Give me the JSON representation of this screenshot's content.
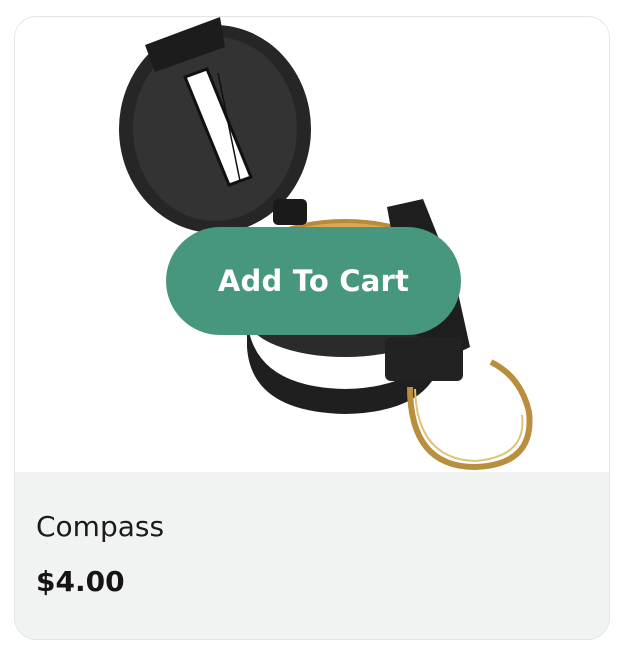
{
  "product": {
    "image_alt": "compass-image",
    "name": "Compass",
    "price": "$4.00",
    "add_to_cart_label": "Add To Cart"
  },
  "colors": {
    "button": "#47977e",
    "info_background": "#f1f3f2",
    "card_border": "#e3e5e4"
  }
}
